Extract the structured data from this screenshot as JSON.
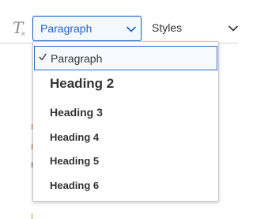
{
  "toolbar": {
    "clear_formatting_icon": "clear-format-icon",
    "format_select": {
      "value": "Paragraph",
      "icon": "chevron-down-icon"
    },
    "styles_select": {
      "value": "Styles",
      "icon": "chevron-down-icon"
    }
  },
  "dropdown": {
    "selected_icon": "check-icon",
    "options": [
      {
        "label": "Paragraph",
        "selected": true
      },
      {
        "label": "Heading 2",
        "selected": false
      },
      {
        "label": "Heading 3",
        "selected": false
      },
      {
        "label": "Heading 4",
        "selected": false
      },
      {
        "label": "Heading 5",
        "selected": false
      },
      {
        "label": "Heading 6",
        "selected": false
      }
    ]
  },
  "colors": {
    "accent": "#2a6ac8",
    "accent_text": "#1f63c7",
    "text": "#333333",
    "border": "#c8c8c8"
  }
}
